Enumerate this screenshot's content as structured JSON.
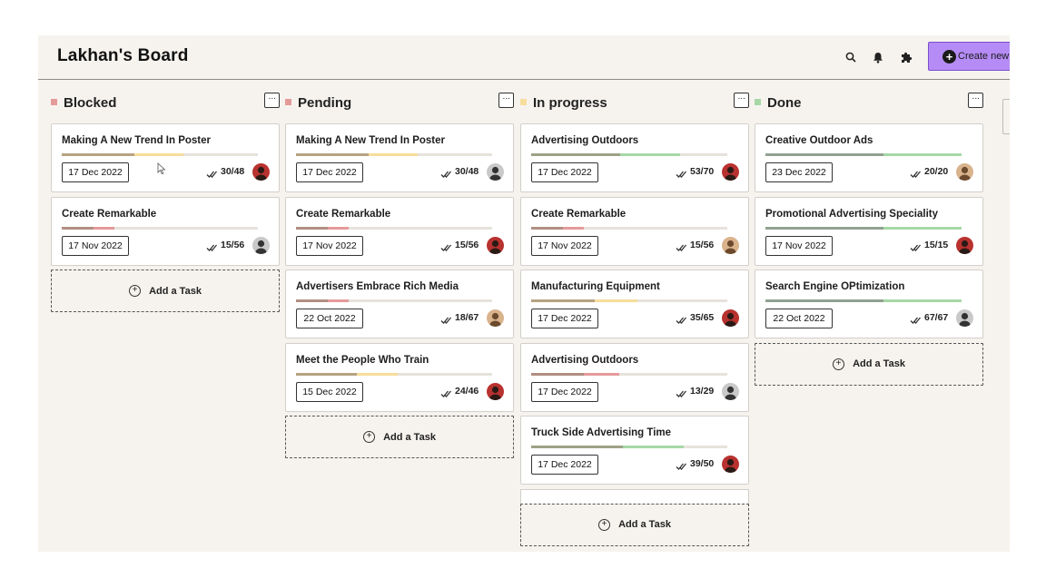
{
  "header": {
    "title": "Lakhan's Board",
    "create_label": "Create new",
    "icons": [
      "search-icon",
      "bell-icon",
      "puzzle-icon"
    ]
  },
  "colors": {
    "accent": "#b58cf5",
    "blocked": "#e59a9a",
    "pending": "#e59a9a",
    "in_progress": "#f7dc9c",
    "done": "#a6d8a6"
  },
  "add_task_label": "Add a Task",
  "columns": [
    {
      "title": "Blocked",
      "cards": [
        {
          "title": "Making A New Trend In Poster",
          "date": "17 Dec 2022",
          "count": "30/48",
          "progress": 0.62,
          "color": "#f7dc9c"
        },
        {
          "title": "Create Remarkable",
          "date": "17 Nov 2022",
          "count": "15/56",
          "progress": 0.27,
          "color": "#e59a9a"
        }
      ]
    },
    {
      "title": "Pending",
      "cards": [
        {
          "title": "Making A New Trend In Poster",
          "date": "17 Dec 2022",
          "count": "30/48",
          "progress": 0.62,
          "color": "#f7dc9c"
        },
        {
          "title": "Create Remarkable",
          "date": "17 Nov 2022",
          "count": "15/56",
          "progress": 0.27,
          "color": "#e59a9a"
        },
        {
          "title": "Advertisers Embrace Rich Media",
          "date": "22 Oct 2022",
          "count": "18/67",
          "progress": 0.27,
          "color": "#e59a9a"
        },
        {
          "title": "Meet the People Who Train",
          "date": "15 Dec 2022",
          "count": "24/46",
          "progress": 0.52,
          "color": "#f7dc9c"
        }
      ]
    },
    {
      "title": "In progress",
      "cards": [
        {
          "title": "Advertising Outdoors",
          "date": "17 Dec 2022",
          "count": "53/70",
          "progress": 0.76,
          "color": "#a6d8a6"
        },
        {
          "title": "Create Remarkable",
          "date": "17 Nov 2022",
          "count": "15/56",
          "progress": 0.27,
          "color": "#e59a9a"
        },
        {
          "title": "Manufacturing Equipment",
          "date": "17 Dec 2022",
          "count": "35/65",
          "progress": 0.54,
          "color": "#f7dc9c"
        },
        {
          "title": "Advertising Outdoors",
          "date": "17 Dec 2022",
          "count": "13/29",
          "progress": 0.45,
          "color": "#e59a9a"
        },
        {
          "title": "Truck Side Advertising Time",
          "date": "17 Dec 2022",
          "count": "39/50",
          "progress": 0.78,
          "color": "#a6d8a6"
        }
      ]
    },
    {
      "title": "Done",
      "cards": [
        {
          "title": "Creative Outdoor Ads",
          "date": "23 Dec 2022",
          "count": "20/20",
          "progress": 1.0,
          "color": "#a6d8a6"
        },
        {
          "title": "Promotional Advertising Speciality",
          "date": "17 Nov 2022",
          "count": "15/15",
          "progress": 1.0,
          "color": "#a6d8a6"
        },
        {
          "title": "Search Engine OPtimization",
          "date": "22 Oct 2022",
          "count": "67/67",
          "progress": 1.0,
          "color": "#a6d8a6"
        }
      ]
    }
  ]
}
